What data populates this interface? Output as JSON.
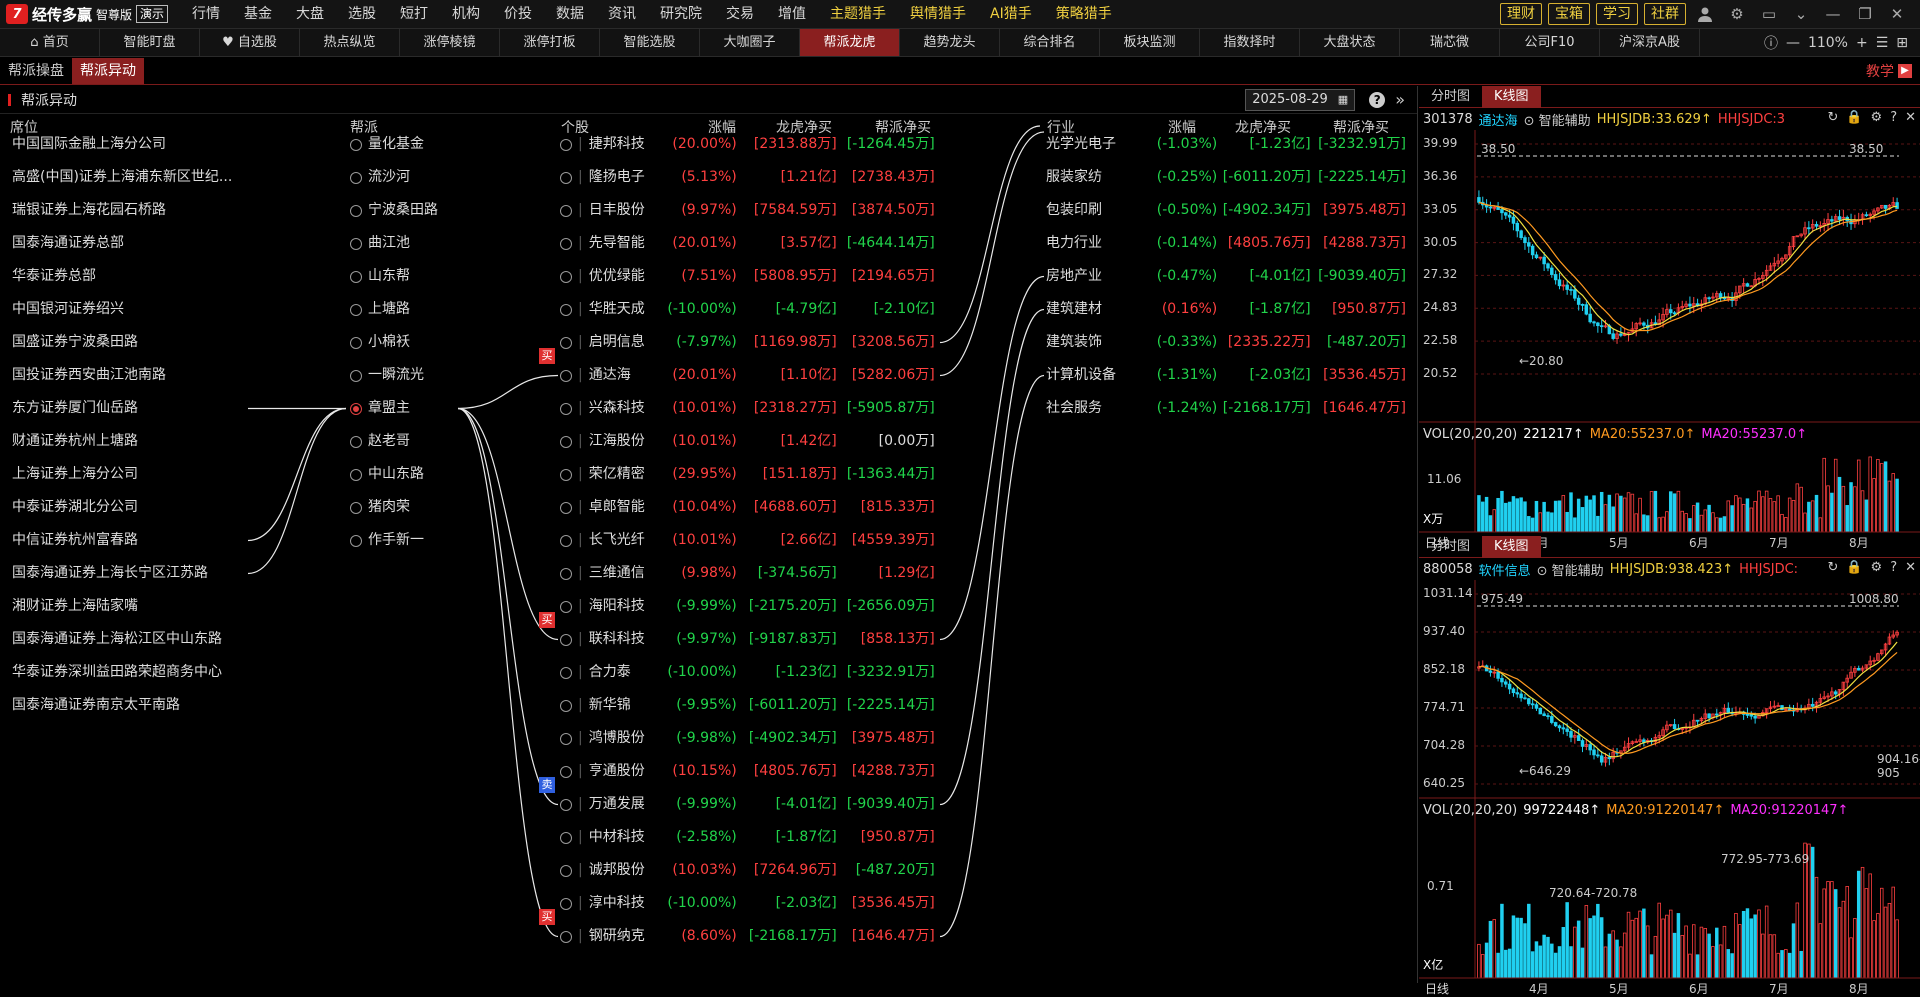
{
  "app": {
    "name": "经传多赢",
    "edition": "智尊版",
    "demo": "演示"
  },
  "menu": [
    "行情",
    "基金",
    "大盘",
    "选股",
    "短打",
    "机构",
    "价投",
    "数据",
    "资讯",
    "研究院",
    "交易",
    "增值"
  ],
  "menu_hot": [
    "主题猎手",
    "舆情猎手",
    "AI猎手",
    "策略猎手"
  ],
  "top_buttons": [
    "理财",
    "宝箱",
    "学习",
    "社群"
  ],
  "tabs": [
    "首页",
    "智能盯盘",
    "自选股",
    "热点纵览",
    "涨停棱镜",
    "涨停打板",
    "智能选股",
    "大咖圈子",
    "帮派龙虎",
    "趋势龙头",
    "综合排名",
    "板块监测",
    "指数择时",
    "大盘状态",
    "瑞芯微",
    "公司F10",
    "沪深京A股"
  ],
  "active_tab": "帮派龙虎",
  "zoom": "110%",
  "subtabs": [
    "帮派操盘",
    "帮派异动"
  ],
  "teach": "教学",
  "panel": {
    "title": "帮派异动",
    "date": "2025-08-29"
  },
  "headers": {
    "seat": "席位",
    "gang": "帮派",
    "stock": "个股",
    "chg": "涨幅",
    "lhb": "龙虎净买",
    "gangbuy": "帮派净买",
    "industry": "行业",
    "ichg": "涨幅",
    "ilhb": "龙虎净买",
    "igang": "帮派净买"
  },
  "seats": [
    "中国国际金融上海分公司",
    "高盛(中国)证券上海浦东新区世纪...",
    "瑞银证券上海花园石桥路",
    "国泰海通证券总部",
    "华泰证券总部",
    "中国银河证券绍兴",
    "国盛证券宁波桑田路",
    "国投证券西安曲江池南路",
    "东方证券厦门仙岳路",
    "财通证券杭州上塘路",
    "上海证券上海分公司",
    "中泰证券湖北分公司",
    "中信证券杭州富春路",
    "国泰海通证券上海长宁区江苏路",
    "湘财证券上海陆家嘴",
    "国泰海通证券上海松江区中山东路",
    "华泰证券深圳益田路荣超商务中心",
    "国泰海通证券南京太平南路"
  ],
  "gangs": [
    "量化基金",
    "流沙河",
    "宁波桑田路",
    "曲江池",
    "山东帮",
    "上塘路",
    "小棉袄",
    "一瞬流光",
    "章盟主",
    "赵老哥",
    "中山东路",
    "猪肉荣",
    "作手新一"
  ],
  "selected_gang": "章盟主",
  "stocks": [
    {
      "name": "捷邦科技",
      "chg": "(20.00%)",
      "lhb": "[2313.88万]",
      "gb": "[-1264.45万]",
      "c": [
        "red",
        "red",
        "grn"
      ]
    },
    {
      "name": "隆扬电子",
      "chg": "(5.13%)",
      "lhb": "[1.21亿]",
      "gb": "[2738.43万]",
      "c": [
        "red",
        "red",
        "red"
      ]
    },
    {
      "name": "日丰股份",
      "chg": "(9.97%)",
      "lhb": "[7584.59万]",
      "gb": "[3874.50万]",
      "c": [
        "red",
        "red",
        "red"
      ]
    },
    {
      "name": "先导智能",
      "chg": "(20.01%)",
      "lhb": "[3.57亿]",
      "gb": "[-4644.14万]",
      "c": [
        "red",
        "red",
        "grn"
      ]
    },
    {
      "name": "优优绿能",
      "chg": "(7.51%)",
      "lhb": "[5808.95万]",
      "gb": "[2194.65万]",
      "c": [
        "red",
        "red",
        "red"
      ]
    },
    {
      "name": "华胜天成",
      "chg": "(-10.00%)",
      "lhb": "[-4.79亿]",
      "gb": "[-2.10亿]",
      "c": [
        "grn",
        "grn",
        "grn"
      ]
    },
    {
      "name": "启明信息",
      "chg": "(-7.97%)",
      "lhb": "[1169.98万]",
      "gb": "[3208.56万]",
      "c": [
        "grn",
        "red",
        "red"
      ]
    },
    {
      "name": "通达海",
      "chg": "(20.01%)",
      "lhb": "[1.10亿]",
      "gb": "[5282.06万]",
      "c": [
        "red",
        "red",
        "red"
      ]
    },
    {
      "name": "兴森科技",
      "chg": "(10.01%)",
      "lhb": "[2318.27万]",
      "gb": "[-5905.87万]",
      "c": [
        "red",
        "red",
        "grn"
      ]
    },
    {
      "name": "江海股份",
      "chg": "(10.01%)",
      "lhb": "[1.42亿]",
      "gb": "[0.00万]",
      "c": [
        "red",
        "red",
        "wht"
      ]
    },
    {
      "name": "荣亿精密",
      "chg": "(29.95%)",
      "lhb": "[151.18万]",
      "gb": "[-1363.44万]",
      "c": [
        "red",
        "red",
        "grn"
      ]
    },
    {
      "name": "卓郎智能",
      "chg": "(10.04%)",
      "lhb": "[4688.60万]",
      "gb": "[815.33万]",
      "c": [
        "red",
        "red",
        "red"
      ]
    },
    {
      "name": "长飞光纤",
      "chg": "(10.01%)",
      "lhb": "[2.66亿]",
      "gb": "[4559.39万]",
      "c": [
        "red",
        "red",
        "red"
      ]
    },
    {
      "name": "三维通信",
      "chg": "(9.98%)",
      "lhb": "[-374.56万]",
      "gb": "[1.29亿]",
      "c": [
        "red",
        "grn",
        "red"
      ]
    },
    {
      "name": "海阳科技",
      "chg": "(-9.99%)",
      "lhb": "[-2175.20万]",
      "gb": "[-2656.09万]",
      "c": [
        "grn",
        "grn",
        "grn"
      ]
    },
    {
      "name": "联科科技",
      "chg": "(-9.97%)",
      "lhb": "[-9187.83万]",
      "gb": "[858.13万]",
      "c": [
        "grn",
        "grn",
        "red"
      ]
    },
    {
      "name": "合力泰",
      "chg": "(-10.00%)",
      "lhb": "[-1.23亿]",
      "gb": "[-3232.91万]",
      "c": [
        "grn",
        "grn",
        "grn"
      ]
    },
    {
      "name": "新华锦",
      "chg": "(-9.95%)",
      "lhb": "[-6011.20万]",
      "gb": "[-2225.14万]",
      "c": [
        "grn",
        "grn",
        "grn"
      ]
    },
    {
      "name": "鸿博股份",
      "chg": "(-9.98%)",
      "lhb": "[-4902.34万]",
      "gb": "[3975.48万]",
      "c": [
        "grn",
        "grn",
        "red"
      ]
    },
    {
      "name": "亨通股份",
      "chg": "(10.15%)",
      "lhb": "[4805.76万]",
      "gb": "[4288.73万]",
      "c": [
        "red",
        "red",
        "red"
      ]
    },
    {
      "name": "万通发展",
      "chg": "(-9.99%)",
      "lhb": "[-4.01亿]",
      "gb": "[-9039.40万]",
      "c": [
        "grn",
        "grn",
        "grn"
      ]
    },
    {
      "name": "中材科技",
      "chg": "(-2.58%)",
      "lhb": "[-1.87亿]",
      "gb": "[950.87万]",
      "c": [
        "grn",
        "grn",
        "red"
      ]
    },
    {
      "name": "诚邦股份",
      "chg": "(10.03%)",
      "lhb": "[7264.96万]",
      "gb": "[-487.20万]",
      "c": [
        "red",
        "red",
        "grn"
      ]
    },
    {
      "name": "淳中科技",
      "chg": "(-10.00%)",
      "lhb": "[-2.03亿]",
      "gb": "[3536.45万]",
      "c": [
        "grn",
        "grn",
        "red"
      ]
    },
    {
      "name": "钢研纳克",
      "chg": "(8.60%)",
      "lhb": "[-2168.17万]",
      "gb": "[1646.47万]",
      "c": [
        "red",
        "grn",
        "red"
      ]
    }
  ],
  "industries": [
    {
      "name": "光学光电子",
      "chg": "(-1.03%)",
      "lhb": "[-1.23亿]",
      "gb": "[-3232.91万]",
      "c": [
        "grn",
        "grn",
        "grn"
      ]
    },
    {
      "name": "服装家纺",
      "chg": "(-0.25%)",
      "lhb": "[-6011.20万]",
      "gb": "[-2225.14万]",
      "c": [
        "grn",
        "grn",
        "grn"
      ]
    },
    {
      "name": "包装印刷",
      "chg": "(-0.50%)",
      "lhb": "[-4902.34万]",
      "gb": "[3975.48万]",
      "c": [
        "grn",
        "grn",
        "red"
      ]
    },
    {
      "name": "电力行业",
      "chg": "(-0.14%)",
      "lhb": "[4805.76万]",
      "gb": "[4288.73万]",
      "c": [
        "grn",
        "red",
        "red"
      ]
    },
    {
      "name": "房地产业",
      "chg": "(-0.47%)",
      "lhb": "[-4.01亿]",
      "gb": "[-9039.40万]",
      "c": [
        "grn",
        "grn",
        "grn"
      ]
    },
    {
      "name": "建筑建材",
      "chg": "(0.16%)",
      "lhb": "[-1.87亿]",
      "gb": "[950.87万]",
      "c": [
        "red",
        "grn",
        "red"
      ]
    },
    {
      "name": "建筑装饰",
      "chg": "(-0.33%)",
      "lhb": "[2335.22万]",
      "gb": "[-487.20万]",
      "c": [
        "grn",
        "red",
        "grn"
      ]
    },
    {
      "name": "计算机设备",
      "chg": "(-1.31%)",
      "lhb": "[-2.03亿]",
      "gb": "[3536.45万]",
      "c": [
        "grn",
        "grn",
        "red"
      ]
    },
    {
      "name": "社会服务",
      "chg": "(-1.24%)",
      "lhb": "[-2168.17万]",
      "gb": "[1646.47万]",
      "c": [
        "grn",
        "grn",
        "red"
      ]
    }
  ],
  "badges": {
    "buy": "买",
    "sell": "卖"
  },
  "chart1": {
    "tabs": [
      "分时图",
      "K线图"
    ],
    "code": "301378",
    "name": "通达海",
    "assist": "智能辅助",
    "ind1": "HHJSJDB:33.629",
    "ind2": "HHJSJDC:3",
    "ylabels": [
      "39.99",
      "36.36",
      "33.05",
      "30.05",
      "27.32",
      "24.83",
      "22.58",
      "20.52"
    ],
    "hi": "38.50",
    "hi2": "38.50",
    "lo": "20.80",
    "vol": {
      "label": "VOL(20,20,20)",
      "v": "221217",
      "ma1": "MA20:55237.0",
      "ma2": "MA20:55237.0",
      "y": "11.06",
      "unit": "X万"
    },
    "months": [
      "4月",
      "5月",
      "6月",
      "7月",
      "8月"
    ],
    "xlabel": "日线"
  },
  "chart2": {
    "tabs": [
      "分时图",
      "K线图"
    ],
    "code": "880058",
    "name": "软件信息",
    "assist": "智能辅助",
    "ind1": "HHJSJDB:938.423",
    "ind2": "HHJSJDC:",
    "ylabels": [
      "1031.14",
      "937.40",
      "852.18",
      "774.71",
      "704.28",
      "640.25"
    ],
    "hi": "975.49",
    "hi2": "1008.80",
    "lo": "646.29",
    "ann": [
      "904.16-905",
      "772.95-773.69",
      "720.64-720.78"
    ],
    "vol": {
      "label": "VOL(20,20,20)",
      "v": "99722448",
      "ma1": "MA20:91220147",
      "ma2": "MA20:91220147",
      "y": "0.71",
      "unit": "X亿"
    },
    "months": [
      "4月",
      "5月",
      "6月",
      "7月",
      "8月"
    ],
    "xlabel": "日线"
  },
  "colors": {
    "accent": "#8a1f1f",
    "up": "#ff4040",
    "down": "#21d44b",
    "hot": "#f0d040"
  }
}
